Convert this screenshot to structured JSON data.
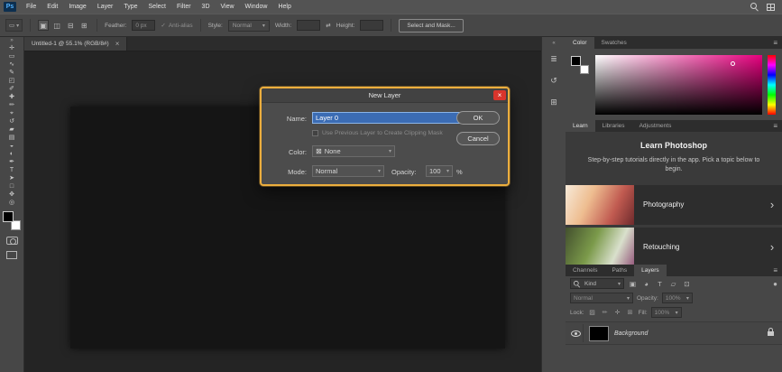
{
  "icons": {
    "caret": "▾",
    "panel_menu": "≡",
    "chevron": "›",
    "swap": "⇄",
    "close": "×",
    "check": "✓",
    "none_x": "⊠",
    "collapse": "»",
    "expand": "«"
  },
  "menu_bar": {
    "logo": "Ps",
    "items": [
      "File",
      "Edit",
      "Image",
      "Layer",
      "Type",
      "Select",
      "Filter",
      "3D",
      "View",
      "Window",
      "Help"
    ]
  },
  "options_bar": {
    "preset_glyph": "▭",
    "selection_modes": [
      {
        "glyph": "▣"
      },
      {
        "glyph": "◫"
      },
      {
        "glyph": "⊟"
      },
      {
        "glyph": "⊞"
      }
    ],
    "feather_label": "Feather:",
    "feather_value": "0 px",
    "anti_alias_label": "Anti-alias",
    "style_label": "Style:",
    "style_value": "Normal",
    "width_label": "Width:",
    "width_value": "",
    "height_label": "Height:",
    "height_value": "",
    "select_and_mask_label": "Select and Mask..."
  },
  "document_tab": {
    "title": "Untitled-1 @ 55.1% (RGB/8#)"
  },
  "toolbar": {
    "tools": [
      {
        "glyph": "✛"
      },
      {
        "glyph": "▭"
      },
      {
        "glyph": "∿"
      },
      {
        "glyph": "✎"
      },
      {
        "glyph": "◰"
      },
      {
        "glyph": "✐"
      },
      {
        "glyph": "✚"
      },
      {
        "glyph": "✏"
      },
      {
        "glyph": "⌖"
      },
      {
        "glyph": "↺"
      },
      {
        "glyph": "▰"
      },
      {
        "glyph": "▤"
      },
      {
        "glyph": "◒"
      },
      {
        "glyph": "◐"
      },
      {
        "glyph": "✒"
      },
      {
        "glyph": "T"
      },
      {
        "glyph": "➤"
      },
      {
        "glyph": "□"
      },
      {
        "glyph": "✥"
      },
      {
        "glyph": "◎"
      }
    ]
  },
  "panel_strip": {
    "icons": [
      {
        "glyph": "≣"
      },
      {
        "glyph": "↺"
      },
      {
        "glyph": "⊞"
      }
    ]
  },
  "dialog": {
    "title": "New Layer",
    "name_label": "Name:",
    "name_value": "Layer 0",
    "clipping_label": "Use Previous Layer to Create Clipping Mask",
    "color_label": "Color:",
    "color_value": "None",
    "mode_label": "Mode:",
    "mode_value": "Normal",
    "opacity_label": "Opacity:",
    "opacity_value": "100",
    "opacity_unit": "%",
    "ok_label": "OK",
    "cancel_label": "Cancel"
  },
  "color_panel": {
    "tabs": [
      "Color",
      "Swatches"
    ]
  },
  "learn_panel": {
    "tabs": [
      "Learn",
      "Libraries",
      "Adjustments"
    ],
    "title": "Learn Photoshop",
    "description": "Step-by-step tutorials directly in the app. Pick a topic below to begin.",
    "items": [
      {
        "label": "Photography"
      },
      {
        "label": "Retouching"
      }
    ]
  },
  "layers_panel": {
    "tabs": [
      "Channels",
      "Paths",
      "Layers"
    ],
    "filter_value": "Kind",
    "filter_icons": [
      {
        "glyph": "▣"
      },
      {
        "glyph": "◕"
      },
      {
        "glyph": "T"
      },
      {
        "glyph": "▱"
      },
      {
        "glyph": "⊡"
      }
    ],
    "filter_toggle_glyph": "●",
    "blend_mode": "Normal",
    "opacity_label": "Opacity:",
    "opacity_value": "100%",
    "lock_label": "Lock:",
    "lock_icons": [
      {
        "glyph": "▨"
      },
      {
        "glyph": "✏"
      },
      {
        "glyph": "✛"
      },
      {
        "glyph": "⊞"
      }
    ],
    "fill_label": "Fill:",
    "fill_value": "100%",
    "layers": [
      {
        "name": "Background"
      }
    ]
  }
}
